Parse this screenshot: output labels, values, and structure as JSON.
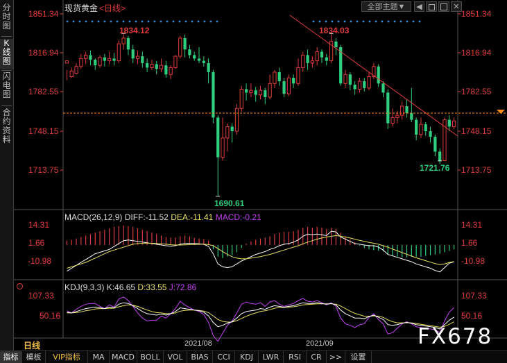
{
  "left_tabs": [
    {
      "label": "分时图",
      "active": false
    },
    {
      "label": "K线图",
      "active": true
    },
    {
      "label": "闪电图",
      "active": false
    },
    {
      "label": "合约资料",
      "active": false
    }
  ],
  "header": {
    "instrument": "现货黄金",
    "period": "<日线>",
    "theme_label": "全部主题▼"
  },
  "price_axis": {
    "labels": [
      "1851.34",
      "1816.94",
      "1782.55",
      "1748.15",
      "1713.75"
    ]
  },
  "annotations": {
    "high1": "1834.12",
    "high2": "1834.03",
    "low1": "1690.61",
    "low2": "1721.76"
  },
  "macd": {
    "label": "MACD(26,12,9)",
    "diff": "DIFF:-11.52",
    "dea": "DEA:-11.41",
    "macd": "MACD:-0.21",
    "axis": [
      "14.31",
      "1.66",
      "-10.98"
    ]
  },
  "kdj": {
    "label": "KDJ(9,3,3)",
    "k": "K:46.65",
    "d": "D:33.55",
    "j": "J:72.86",
    "axis": [
      "107.33",
      "50.16"
    ]
  },
  "dates": [
    "2021/08",
    "2021/09"
  ],
  "period_tag": "日线",
  "bottom_tabs": [
    {
      "label": "指标",
      "active": true
    },
    {
      "label": "模板"
    },
    {
      "label": "VIP指标",
      "vip": true
    },
    {
      "label": "MA"
    },
    {
      "label": "MACD"
    },
    {
      "label": "BOLL"
    },
    {
      "label": "VOL"
    },
    {
      "label": "BIAS"
    },
    {
      "label": "CCI"
    },
    {
      "label": "KDJ"
    },
    {
      "label": "LWR"
    },
    {
      "label": "RSI"
    },
    {
      "label": "CR"
    },
    {
      "label": ">>"
    },
    {
      "label": "设置"
    }
  ],
  "watermark": "FX678",
  "colors": {
    "up": "#e03c3c",
    "down": "#2fcf7f",
    "diff_line": "#ffffff",
    "dea_line": "#e8e060",
    "j_line": "#c040f0",
    "dot": "#3a8fe0",
    "trend": "#e03c3c",
    "current_price": "#ff8c1a"
  },
  "chart_data": {
    "type": "candlestick",
    "candles": [
      [
        1808.0,
        1810.0,
        1802.0,
        1793.0
      ],
      [
        1796.0,
        1801.0,
        1804.0,
        1795.0
      ],
      [
        1799.0,
        1805.0,
        1808.0,
        1798.0
      ],
      [
        1805.0,
        1812.0,
        1816.0,
        1803.0
      ],
      [
        1812.0,
        1815.0,
        1818.0,
        1807.0
      ],
      [
        1815.0,
        1811.0,
        1819.0,
        1806.0
      ],
      [
        1811.0,
        1806.0,
        1812.0,
        1802.0
      ],
      [
        1806.0,
        1813.0,
        1815.0,
        1804.0
      ],
      [
        1813.0,
        1810.0,
        1816.0,
        1805.0
      ],
      [
        1810.0,
        1812.0,
        1818.0,
        1807.0
      ],
      [
        1812.0,
        1810.0,
        1817.0,
        1806.0
      ],
      [
        1810.0,
        1825.0,
        1828.0,
        1808.0
      ],
      [
        1825.0,
        1830.0,
        1834.1,
        1820.0
      ],
      [
        1830.0,
        1820.0,
        1832.0,
        1815.0
      ],
      [
        1820.0,
        1812.0,
        1824.0,
        1808.0
      ],
      [
        1812.0,
        1814.0,
        1819.0,
        1807.0
      ],
      [
        1814.0,
        1808.0,
        1818.0,
        1804.0
      ],
      [
        1808.0,
        1804.0,
        1812.0,
        1800.0
      ],
      [
        1804.0,
        1807.0,
        1811.0,
        1802.0
      ],
      [
        1807.0,
        1803.0,
        1810.0,
        1798.0
      ],
      [
        1803.0,
        1806.0,
        1812.0,
        1800.0
      ],
      [
        1806.0,
        1798.0,
        1810.0,
        1795.0
      ],
      [
        1798.0,
        1804.0,
        1806.0,
        1794.0
      ],
      [
        1804.0,
        1814.0,
        1815.0,
        1803.0
      ],
      [
        1814.0,
        1830.0,
        1832.0,
        1812.0
      ],
      [
        1830.0,
        1820.0,
        1833.0,
        1813.0
      ],
      [
        1820.0,
        1815.0,
        1824.0,
        1812.0
      ],
      [
        1815.0,
        1812.0,
        1818.0,
        1810.0
      ],
      [
        1812.0,
        1810.0,
        1822.0,
        1808.0
      ],
      [
        1810.0,
        1808.0,
        1814.0,
        1805.0
      ],
      [
        1808.0,
        1800.0,
        1812.0,
        1790.0
      ],
      [
        1800.0,
        1760.0,
        1802.0,
        1755.0
      ],
      [
        1760.0,
        1725.0,
        1762.0,
        1690.6
      ],
      [
        1725.0,
        1742.0,
        1760.0,
        1722.0
      ],
      [
        1742.0,
        1752.0,
        1755.0,
        1730.0
      ],
      [
        1752.0,
        1748.0,
        1755.0,
        1738.0
      ],
      [
        1748.0,
        1768.0,
        1772.0,
        1745.0
      ],
      [
        1768.0,
        1785.0,
        1788.0,
        1765.0
      ],
      [
        1785.0,
        1782.0,
        1790.0,
        1775.0
      ],
      [
        1782.0,
        1784.0,
        1790.0,
        1778.0
      ],
      [
        1784.0,
        1780.0,
        1787.0,
        1774.0
      ],
      [
        1780.0,
        1784.0,
        1788.0,
        1776.0
      ],
      [
        1784.0,
        1778.0,
        1786.0,
        1772.0
      ],
      [
        1778.0,
        1790.0,
        1798.0,
        1776.0
      ],
      [
        1790.0,
        1800.0,
        1802.0,
        1786.0
      ],
      [
        1800.0,
        1792.0,
        1804.0,
        1788.0
      ],
      [
        1792.0,
        1781.0,
        1795.0,
        1778.0
      ],
      [
        1781.0,
        1795.0,
        1798.0,
        1779.0
      ],
      [
        1795.0,
        1790.0,
        1798.0,
        1786.0
      ],
      [
        1790.0,
        1804.0,
        1812.0,
        1788.0
      ],
      [
        1804.0,
        1815.0,
        1818.0,
        1800.0
      ],
      [
        1815.0,
        1808.0,
        1820.0,
        1802.0
      ],
      [
        1808.0,
        1810.0,
        1814.0,
        1804.0
      ],
      [
        1810.0,
        1818.0,
        1822.0,
        1806.0
      ],
      [
        1818.0,
        1813.0,
        1820.0,
        1808.0
      ],
      [
        1813.0,
        1810.0,
        1816.0,
        1806.0
      ],
      [
        1810.0,
        1827.0,
        1834.0,
        1808.0
      ],
      [
        1827.0,
        1822.0,
        1830.0,
        1815.0
      ],
      [
        1822.0,
        1790.0,
        1824.0,
        1788.0
      ],
      [
        1790.0,
        1798.0,
        1802.0,
        1786.0
      ],
      [
        1798.0,
        1789.0,
        1800.0,
        1784.0
      ],
      [
        1789.0,
        1785.0,
        1792.0,
        1780.0
      ],
      [
        1785.0,
        1792.0,
        1795.0,
        1782.0
      ],
      [
        1792.0,
        1786.0,
        1795.0,
        1783.0
      ],
      [
        1786.0,
        1796.0,
        1800.0,
        1784.0
      ],
      [
        1796.0,
        1805.0,
        1808.0,
        1794.0
      ],
      [
        1805.0,
        1790.0,
        1807.0,
        1787.0
      ],
      [
        1790.0,
        1782.0,
        1792.0,
        1778.0
      ],
      [
        1782.0,
        1755.0,
        1785.0,
        1750.0
      ],
      [
        1755.0,
        1760.0,
        1768.0,
        1752.0
      ],
      [
        1760.0,
        1762.0,
        1766.0,
        1755.0
      ],
      [
        1762.0,
        1770.0,
        1774.0,
        1758.0
      ],
      [
        1770.0,
        1764.0,
        1776.0,
        1760.0
      ],
      [
        1764.0,
        1758.0,
        1786.0,
        1756.0
      ],
      [
        1758.0,
        1745.0,
        1760.0,
        1740.0
      ],
      [
        1745.0,
        1754.0,
        1760.0,
        1742.0
      ],
      [
        1754.0,
        1748.0,
        1756.0,
        1744.0
      ],
      [
        1748.0,
        1743.0,
        1752.0,
        1738.0
      ],
      [
        1743.0,
        1730.0,
        1745.0,
        1726.0
      ],
      [
        1730.0,
        1722.0,
        1733.0,
        1719.0
      ],
      [
        1722.0,
        1758.0,
        1760.0,
        1721.8
      ],
      [
        1758.0,
        1752.0,
        1762.0,
        1748.0
      ],
      [
        1752.0,
        1757.0,
        1760.0,
        1750.0
      ]
    ],
    "macd_hist": [
      3.0,
      3.5,
      4.5,
      5.5,
      6.5,
      7.5,
      8.5,
      9.5,
      10.5,
      11.5,
      12.5,
      13.0,
      13.5,
      13.0,
      12.5,
      11.5,
      10.5,
      9.5,
      8.5,
      7.5,
      6.5,
      5.5,
      5.0,
      5.0,
      6.0,
      6.5,
      6.0,
      5.0,
      4.5,
      4.0,
      3.0,
      -3.0,
      -8.0,
      -9.0,
      -8.0,
      -7.0,
      -5.0,
      -2.0,
      1.0,
      2.5,
      3.5,
      4.5,
      5.0,
      6.0,
      7.5,
      8.5,
      9.0,
      9.0,
      9.5,
      10.5,
      12.0,
      12.5,
      12.0,
      12.5,
      12.0,
      11.0,
      12.0,
      11.0,
      8.5,
      6.0,
      4.0,
      2.0,
      -0.5,
      -2.0,
      -3.0,
      -3.5,
      -4.0,
      -4.5,
      -6.5,
      -7.5,
      -8.0,
      -8.5,
      -8.5,
      -8.0,
      -8.0,
      -8.0,
      -7.5,
      -7.0,
      -6.5,
      -6.0,
      -5.0,
      -4.0,
      -3.0
    ],
    "diff": [
      -18.0,
      -16.0,
      -14.0,
      -12.0,
      -10.0,
      -8.0,
      -6.0,
      -5.0,
      -4.0,
      -3.0,
      -1.0,
      1.0,
      3.0,
      3.5,
      3.0,
      2.5,
      2.0,
      1.5,
      1.0,
      0.5,
      0.0,
      -0.5,
      -0.8,
      -0.5,
      0.5,
      1.0,
      1.2,
      1.0,
      0.8,
      0.5,
      -1.0,
      -6.0,
      -13.0,
      -15.0,
      -15.5,
      -15.0,
      -13.0,
      -11.0,
      -9.5,
      -8.0,
      -6.5,
      -5.5,
      -4.5,
      -3.0,
      -2.0,
      -0.5,
      0.5,
      1.0,
      2.0,
      3.5,
      6.0,
      7.5,
      7.0,
      7.5,
      7.0,
      6.5,
      9.5,
      9.0,
      5.5,
      4.0,
      2.5,
      1.0,
      0.5,
      0.0,
      -0.5,
      -0.5,
      -1.5,
      -3.5,
      -6.5,
      -7.5,
      -8.5,
      -9.5,
      -10.5,
      -11.5,
      -13.0,
      -14.0,
      -15.0,
      -16.0,
      -17.5,
      -18.5,
      -15.5,
      -12.5,
      -11.5
    ],
    "dea": [
      -16.0,
      -15.0,
      -14.0,
      -13.0,
      -12.0,
      -10.5,
      -9.0,
      -7.5,
      -6.0,
      -4.5,
      -3.5,
      -2.5,
      -1.5,
      -0.5,
      0.5,
      1.0,
      1.2,
      1.3,
      1.2,
      1.0,
      0.8,
      0.5,
      0.2,
      0.0,
      0.0,
      0.1,
      0.3,
      0.4,
      0.5,
      0.5,
      0.3,
      -0.5,
      -2.5,
      -4.5,
      -6.5,
      -8.0,
      -9.0,
      -9.5,
      -9.5,
      -9.0,
      -8.5,
      -8.0,
      -7.2,
      -6.5,
      -5.5,
      -4.5,
      -3.5,
      -2.5,
      -1.5,
      -0.5,
      0.8,
      2.0,
      3.0,
      4.0,
      4.8,
      5.5,
      6.0,
      6.5,
      6.0,
      5.5,
      4.8,
      4.0,
      3.2,
      2.5,
      1.8,
      1.2,
      0.5,
      -0.5,
      -1.5,
      -2.8,
      -4.0,
      -5.2,
      -6.4,
      -7.6,
      -8.8,
      -9.8,
      -10.8,
      -11.8,
      -12.8,
      -13.5,
      -13.0,
      -12.0,
      -11.4
    ],
    "kdj_k": [
      60,
      58,
      62,
      66,
      70,
      72,
      74,
      72,
      70,
      74,
      72,
      82,
      86,
      84,
      78,
      70,
      62,
      56,
      54,
      52,
      55,
      52,
      56,
      62,
      72,
      70,
      68,
      66,
      64,
      60,
      50,
      32,
      20,
      24,
      30,
      34,
      44,
      56,
      62,
      64,
      66,
      70,
      68,
      74,
      78,
      76,
      74,
      76,
      78,
      82,
      86,
      84,
      84,
      86,
      84,
      82,
      84,
      80,
      66,
      56,
      50,
      44,
      44,
      42,
      48,
      52,
      46,
      40,
      26,
      24,
      26,
      30,
      32,
      30,
      26,
      24,
      22,
      20,
      18,
      14,
      26,
      38,
      46.65
    ],
    "kdj_d": [
      58,
      58,
      59,
      61,
      64,
      66,
      69,
      70,
      70,
      71,
      71,
      75,
      78,
      80,
      79,
      76,
      71,
      66,
      62,
      59,
      58,
      56,
      56,
      58,
      63,
      65,
      66,
      66,
      65,
      63,
      59,
      50,
      40,
      35,
      33,
      33,
      37,
      43,
      49,
      54,
      58,
      62,
      64,
      67,
      71,
      73,
      73,
      74,
      75,
      77,
      80,
      81,
      82,
      83,
      83,
      83,
      83,
      82,
      77,
      70,
      63,
      57,
      53,
      49,
      49,
      50,
      49,
      46,
      39,
      34,
      31,
      31,
      31,
      31,
      29,
      27,
      25,
      23,
      21,
      19,
      21,
      27,
      33.55
    ],
    "kdj_j": [
      64,
      58,
      68,
      76,
      82,
      84,
      84,
      76,
      70,
      80,
      74,
      96,
      102,
      92,
      76,
      58,
      44,
      36,
      38,
      38,
      49,
      44,
      56,
      70,
      90,
      80,
      72,
      66,
      62,
      54,
      32,
      -4,
      -20,
      2,
      24,
      36,
      58,
      82,
      88,
      84,
      82,
      86,
      76,
      88,
      92,
      82,
      76,
      80,
      84,
      92,
      98,
      90,
      88,
      92,
      86,
      80,
      86,
      76,
      44,
      28,
      24,
      18,
      26,
      28,
      46,
      56,
      40,
      28,
      0,
      4,
      16,
      28,
      34,
      28,
      20,
      18,
      16,
      14,
      12,
      4,
      36,
      60,
      72.86
    ]
  }
}
